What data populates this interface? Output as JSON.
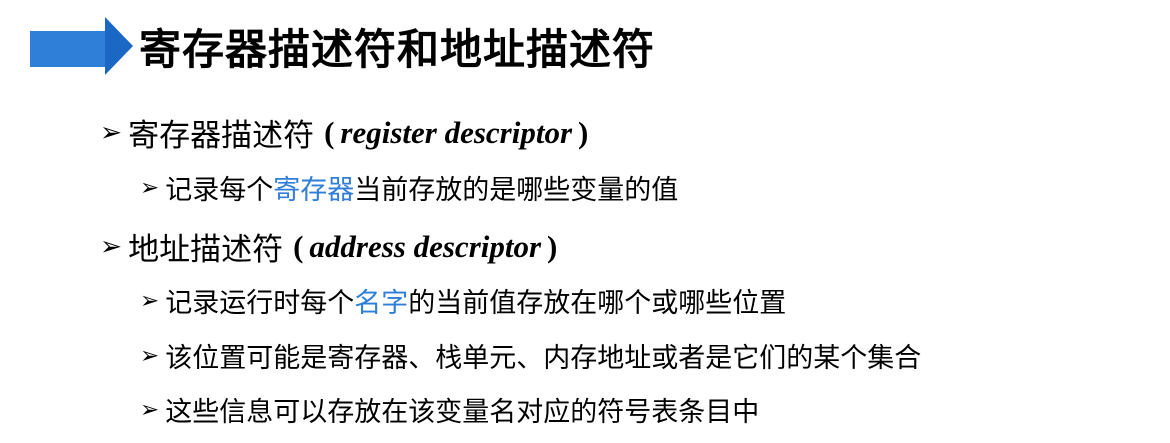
{
  "title": "寄存器描述符和地址描述符",
  "arrow_glyph": "➢",
  "bullets": [
    {
      "level": 1,
      "cn": "寄存器描述符",
      "paren_open": "(",
      "en": "register descriptor",
      "paren_close": ")"
    },
    {
      "level": 2,
      "before": "记录每个",
      "highlight": "寄存器",
      "after": "当前存放的是哪些变量的值"
    },
    {
      "level": 1,
      "cn": "地址描述符",
      "paren_open": "(",
      "en": "address descriptor",
      "paren_close": ")"
    },
    {
      "level": 2,
      "before": "记录运行时每个",
      "highlight": "名字",
      "after": "的当前值存放在哪个或哪些位置"
    },
    {
      "level": 2,
      "text": "该位置可能是寄存器、栈单元、内存地址或者是它们的某个集合"
    },
    {
      "level": 2,
      "text": "这些信息可以存放在该变量名对应的符号表条目中"
    }
  ],
  "colors": {
    "accent": "#2f7ed8",
    "accent_dark": "#1a68c4",
    "text": "#000000"
  }
}
